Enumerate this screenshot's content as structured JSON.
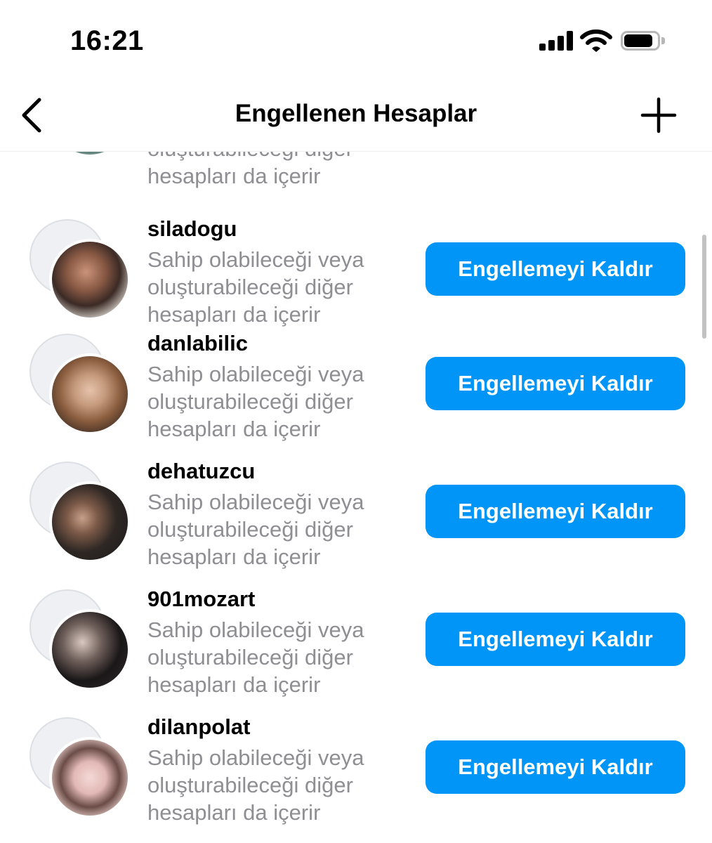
{
  "status_bar": {
    "time": "16:21"
  },
  "header": {
    "title": "Engellenen Hesaplar"
  },
  "partial_item": {
    "desc_line1": "oluşturabileceği diğer",
    "desc_line2": "hesapları da içerir"
  },
  "items": [
    {
      "username": "siladogu",
      "desc": "Sahip olabileceği veya oluşturabileceği diğer hesapları da içerir",
      "button": "Engellemeyi Kaldır"
    },
    {
      "username": "danlabilic",
      "desc": "Sahip olabileceği veya oluşturabileceği diğer hesapları da içerir",
      "button": "Engellemeyi Kaldır"
    },
    {
      "username": "dehatuzcu",
      "desc": "Sahip olabileceği veya oluşturabileceği diğer hesapları da içerir",
      "button": "Engellemeyi Kaldır"
    },
    {
      "username": "901mozart",
      "desc": "Sahip olabileceği veya oluşturabileceği diğer hesapları da içerir",
      "button": "Engellemeyi Kaldır"
    },
    {
      "username": "dilanpolat",
      "desc": "Sahip olabileceği veya oluşturabileceği diğer hesapları da içerir",
      "button": "Engellemeyi Kaldır"
    }
  ],
  "icons": {
    "back": "chevron-left-icon",
    "add": "plus-icon",
    "signal": "cellular-signal-icon",
    "wifi": "wifi-icon",
    "battery": "battery-icon"
  },
  "colors": {
    "button": "#0095f6",
    "secondary_text": "#8e8e93"
  }
}
